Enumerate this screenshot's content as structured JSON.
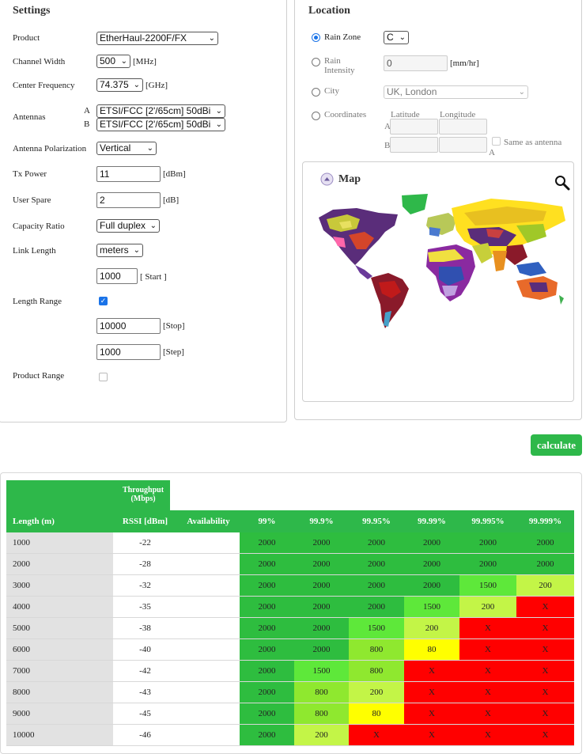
{
  "settings": {
    "title": "Settings",
    "product": {
      "label": "Product",
      "value": "EtherHaul-2200F/FX"
    },
    "channel_width": {
      "label": "Channel Width",
      "value": "500",
      "unit": "[MHz]"
    },
    "center_frequency": {
      "label": "Center Frequency",
      "value": "74.375",
      "unit": "[GHz]"
    },
    "antennas": {
      "label": "Antennas",
      "a_label": "A",
      "a_value": "ETSI/FCC [2'/65cm] 50dBi",
      "b_label": "B",
      "b_value": "ETSI/FCC [2'/65cm] 50dBi"
    },
    "antenna_polarization": {
      "label": "Antenna Polarization",
      "value": "Vertical"
    },
    "tx_power": {
      "label": "Tx Power",
      "value": "11",
      "unit": "[dBm]"
    },
    "user_spare": {
      "label": "User Spare",
      "value": "2",
      "unit": "[dB]"
    },
    "capacity_ratio": {
      "label": "Capacity Ratio",
      "value": "Full duplex"
    },
    "link_length": {
      "label": "Link Length",
      "value": "meters",
      "start_value": "1000",
      "start_unit": "[ Start ]"
    },
    "length_range": {
      "label": "Length Range",
      "checked": true,
      "stop_value": "10000",
      "stop_unit": "[Stop]",
      "step_value": "1000",
      "step_unit": "[Step]"
    },
    "product_range": {
      "label": "Product Range",
      "checked": false
    }
  },
  "location": {
    "title": "Location",
    "rain_zone": {
      "label": "Rain Zone",
      "value": "C",
      "selected": true
    },
    "rain_intensity": {
      "label_line1": "Rain",
      "label_line2": "Intensity",
      "value": "0",
      "unit": "[mm/hr]"
    },
    "city": {
      "label": "City",
      "value": "UK, London"
    },
    "coordinates": {
      "label": "Coordinates",
      "latitude": "Latitude",
      "longitude": "Longitude",
      "a_label": "A",
      "b_label": "B",
      "same_as_antenna": "Same as antenna",
      "same_a": "A"
    },
    "map": {
      "label": "Map"
    }
  },
  "calculate_label": "calculate",
  "results": {
    "throughput_header": "Throughput (Mbps)",
    "columns": [
      "Length (m)",
      "RSSI [dBm]",
      "Availability",
      "99%",
      "99.9%",
      "99.95%",
      "99.99%",
      "99.995%",
      "99.999%"
    ],
    "rows": [
      {
        "length": "1000",
        "rssi": "-22",
        "values": [
          "2000",
          "2000",
          "2000",
          "2000",
          "2000",
          "2000"
        ]
      },
      {
        "length": "2000",
        "rssi": "-28",
        "values": [
          "2000",
          "2000",
          "2000",
          "2000",
          "2000",
          "2000"
        ]
      },
      {
        "length": "3000",
        "rssi": "-32",
        "values": [
          "2000",
          "2000",
          "2000",
          "2000",
          "1500",
          "200"
        ]
      },
      {
        "length": "4000",
        "rssi": "-35",
        "values": [
          "2000",
          "2000",
          "2000",
          "1500",
          "200",
          "X"
        ]
      },
      {
        "length": "5000",
        "rssi": "-38",
        "values": [
          "2000",
          "2000",
          "1500",
          "200",
          "X",
          "X"
        ]
      },
      {
        "length": "6000",
        "rssi": "-40",
        "values": [
          "2000",
          "2000",
          "800",
          "80",
          "X",
          "X"
        ]
      },
      {
        "length": "7000",
        "rssi": "-42",
        "values": [
          "2000",
          "1500",
          "800",
          "X",
          "X",
          "X"
        ]
      },
      {
        "length": "8000",
        "rssi": "-43",
        "values": [
          "2000",
          "800",
          "200",
          "X",
          "X",
          "X"
        ]
      },
      {
        "length": "9000",
        "rssi": "-45",
        "values": [
          "2000",
          "800",
          "80",
          "X",
          "X",
          "X"
        ]
      },
      {
        "length": "10000",
        "rssi": "-46",
        "values": [
          "2000",
          "200",
          "X",
          "X",
          "X",
          "X"
        ]
      }
    ],
    "colors": {
      "2000": "#2ebd3f",
      "1500": "#5ee83a",
      "800": "#8fe82f",
      "200": "#c3f547",
      "80": "#ffff00",
      "X": "#ff0000",
      "header": "#2eb84a"
    }
  }
}
